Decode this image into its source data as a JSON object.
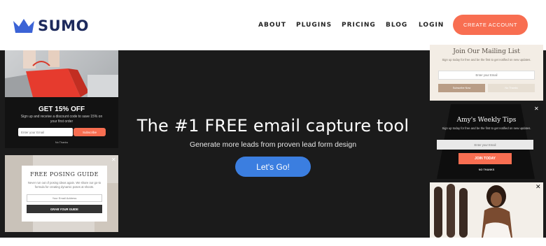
{
  "header": {
    "brand": "SUMO",
    "nav": [
      {
        "label": "ABOUT"
      },
      {
        "label": "PLUGINS"
      },
      {
        "label": "PRICING"
      },
      {
        "label": "BLOG"
      },
      {
        "label": "LOGIN"
      }
    ],
    "cta_label": "CREATE ACCOUNT"
  },
  "hero": {
    "title": "The #1 FREE email capture tool",
    "subtitle": "Generate more leads from proven lead form design",
    "button_label": "Let's Go!"
  },
  "left_cards": [
    {
      "title": "GET 15% OFF",
      "description": "Sign up and receive a discount code to save 15% on your first order",
      "input_placeholder": "Enter your Email",
      "button_label": "Subscribe",
      "decline_label": "No Thanks"
    },
    {
      "title": "FREE POSING GUIDE",
      "description": "Never run out of posing ideas again. We share our go-to formula for creating dynamic poses at shoots.",
      "input_placeholder": "Your Email Address",
      "button_label": "GRAB YOUR GUIDE"
    }
  ],
  "right_cards": [
    {
      "title": "Join Our Mailing List",
      "description": "Sign up today for free and be the first to get notified on new updates.",
      "input_placeholder": "Enter your Email",
      "button_label": "Subscribe Now",
      "secondary_label": "No Thanks"
    },
    {
      "title": "Amy's Weekly Tips",
      "description": "Sign up today for free and be the first to get notified on new updates.",
      "input_placeholder": "Enter your Email",
      "button_label": "JOIN TODAY",
      "decline_label": "NO THANKS"
    }
  ],
  "colors": {
    "brand_navy": "#1d2a5c",
    "crown_blue": "#3b63d6",
    "accent_orange": "#f86e51",
    "hero_button_blue": "#3b7ee0",
    "hero_background": "#1b1b1b"
  },
  "icons": {
    "brand_mark": "crown-icon",
    "close": "close-icon"
  }
}
